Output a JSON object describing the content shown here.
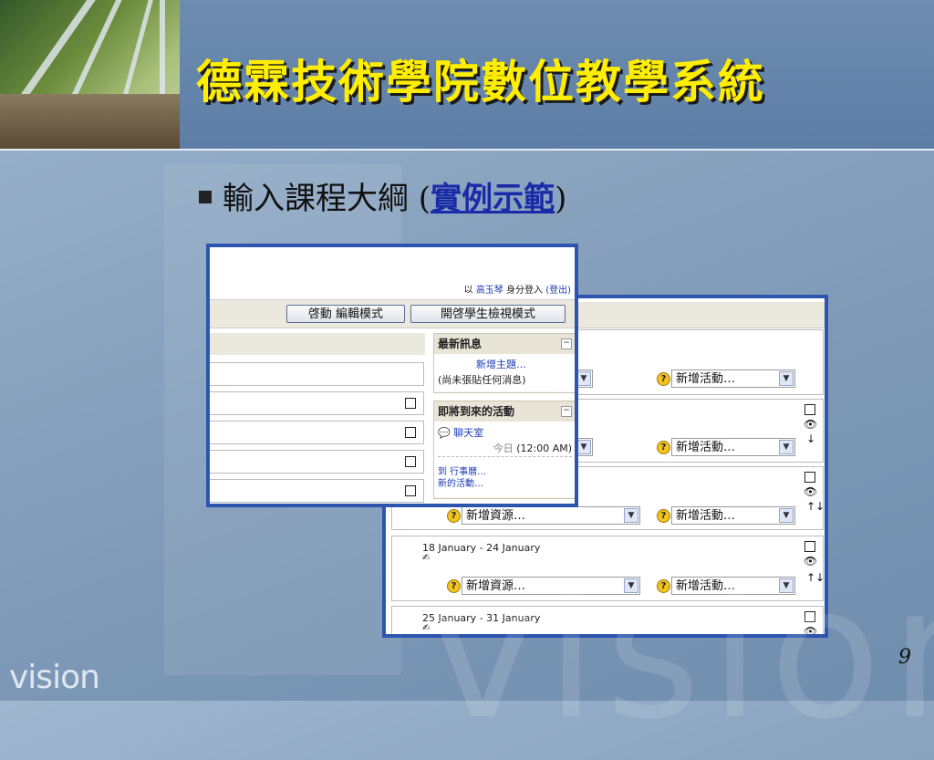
{
  "slide": {
    "title": "德霖技術學院數位教學系統",
    "bullet_text": "輸入課程大綱 (",
    "bullet_link": "實例示範",
    "bullet_close": ")",
    "logo": "vision",
    "watermark": "vision",
    "page_number": "9",
    "colors": {
      "title": "#ffee00",
      "link": "#1a2ba8",
      "window_border": "#2d55b0"
    }
  },
  "back_window": {
    "resource_select": "新增資源…",
    "activity_select": "新增活動…",
    "weeks": [
      "18 January - 24 January",
      "25 January - 31 January"
    ]
  },
  "front_window": {
    "login_prefix": "以",
    "login_user": "高玉琴",
    "login_suffix": "身分登入",
    "logout_label": "(登出)",
    "edit_button": "啓動 編輯模式",
    "student_view_button": "開啓學生檢視模式",
    "news_block": {
      "title": "最新訊息",
      "add_topic": "新增主題…",
      "empty_text": "(尚未張貼任何消息)"
    },
    "upcoming_block": {
      "title": "即將到來的活動",
      "chat_link": "聊天室",
      "today_label": "今日",
      "time": "(12:00 AM)",
      "calendar_link": "到 行事曆…",
      "new_event_link": "新的活動…"
    }
  }
}
